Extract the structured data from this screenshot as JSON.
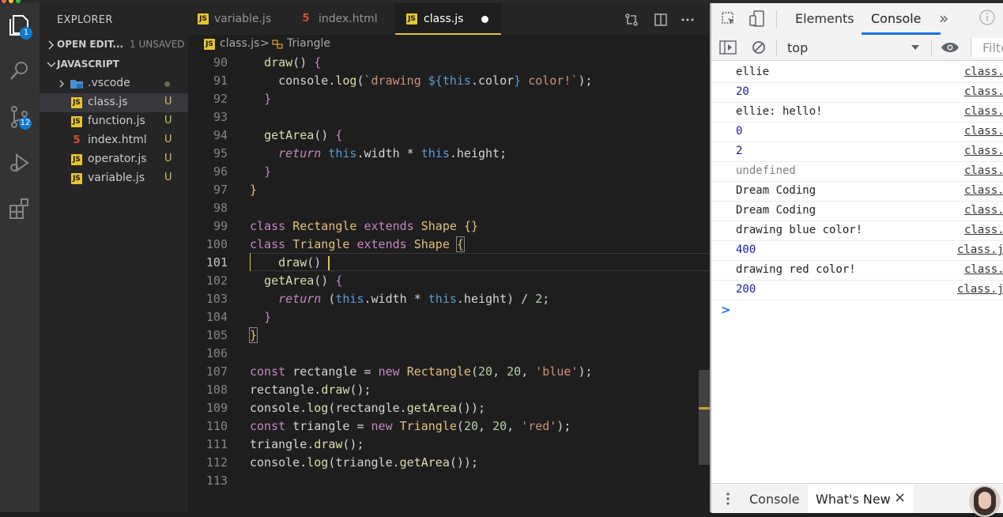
{
  "sidebar": {
    "title": "EXPLORER",
    "open_editors": {
      "label": "OPEN EDIT...",
      "badge": "1 UNSAVED"
    },
    "folder": {
      "label": "JAVASCRIPT"
    },
    "items": [
      {
        "name": ".vscode",
        "type": "folder",
        "status": ""
      },
      {
        "name": "class.js",
        "type": "js",
        "status": "U"
      },
      {
        "name": "function.js",
        "type": "js",
        "status": "U"
      },
      {
        "name": "index.html",
        "type": "html",
        "status": "U"
      },
      {
        "name": "operator.js",
        "type": "js",
        "status": "U"
      },
      {
        "name": "variable.js",
        "type": "js",
        "status": "U"
      }
    ]
  },
  "activity": {
    "explorer_badge": "1",
    "scm_badge": "12"
  },
  "tabs": [
    {
      "label": "variable.js",
      "type": "js"
    },
    {
      "label": "index.html",
      "type": "html"
    },
    {
      "label": "class.js",
      "type": "js",
      "active": true
    }
  ],
  "icons": {
    "js": "JS",
    "html": "5"
  },
  "breadcrumb": {
    "file": "class.js",
    "separator": ">",
    "symbol": "Triangle"
  },
  "code": {
    "line_numbers": [
      "90",
      "91",
      "92",
      "93",
      "94",
      "95",
      "96",
      "97",
      "98",
      "99",
      "100",
      "101",
      "102",
      "103",
      "104",
      "105",
      "106",
      "107",
      "108",
      "109",
      "110",
      "111",
      "112",
      "113"
    ]
  },
  "devtools": {
    "tabs": {
      "elements": "Elements",
      "console": "Console",
      "more": "»"
    },
    "context": "top",
    "filter_placeholder": "Filte",
    "logs": [
      {
        "message": "ellie",
        "source": "class."
      },
      {
        "message": "20",
        "source": "class."
      },
      {
        "message": "ellie: hello!",
        "source": "class."
      },
      {
        "message": "0",
        "source": "class."
      },
      {
        "message": "2",
        "source": "class."
      },
      {
        "message": "undefined",
        "source": "class."
      },
      {
        "message": "Dream Coding",
        "source": "class."
      },
      {
        "message": "Dream Coding",
        "source": "class."
      },
      {
        "message": "drawing blue color!",
        "source": "class."
      },
      {
        "message": "400",
        "source": "class.j"
      },
      {
        "message": "drawing red color!",
        "source": "class."
      },
      {
        "message": "200",
        "source": "class.j"
      }
    ],
    "prompt": ">",
    "drawer": {
      "console": "Console",
      "whats_new": "What's New",
      "close": "×"
    }
  }
}
